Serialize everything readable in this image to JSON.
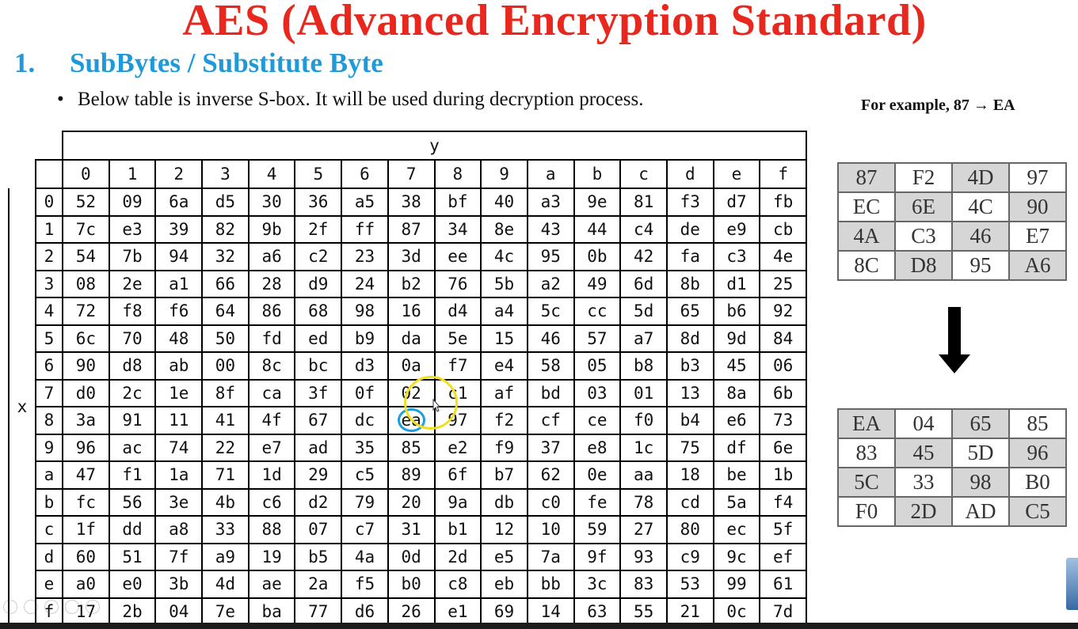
{
  "title": "AES (Advanced Encryption Standard)",
  "section": {
    "number": "1.",
    "heading": "SubBytes / Substitute Byte"
  },
  "bullet": "Below table is inverse S-box. It will be used during decryption process.",
  "example": "For example, 87 → EA",
  "sbox": {
    "y_label": "y",
    "x_label": "x",
    "col_headers": [
      "0",
      "1",
      "2",
      "3",
      "4",
      "5",
      "6",
      "7",
      "8",
      "9",
      "a",
      "b",
      "c",
      "d",
      "e",
      "f"
    ],
    "row_headers": [
      "0",
      "1",
      "2",
      "3",
      "4",
      "5",
      "6",
      "7",
      "8",
      "9",
      "a",
      "b",
      "c",
      "d",
      "e",
      "f"
    ],
    "rows": [
      [
        "52",
        "09",
        "6a",
        "d5",
        "30",
        "36",
        "a5",
        "38",
        "bf",
        "40",
        "a3",
        "9e",
        "81",
        "f3",
        "d7",
        "fb"
      ],
      [
        "7c",
        "e3",
        "39",
        "82",
        "9b",
        "2f",
        "ff",
        "87",
        "34",
        "8e",
        "43",
        "44",
        "c4",
        "de",
        "e9",
        "cb"
      ],
      [
        "54",
        "7b",
        "94",
        "32",
        "a6",
        "c2",
        "23",
        "3d",
        "ee",
        "4c",
        "95",
        "0b",
        "42",
        "fa",
        "c3",
        "4e"
      ],
      [
        "08",
        "2e",
        "a1",
        "66",
        "28",
        "d9",
        "24",
        "b2",
        "76",
        "5b",
        "a2",
        "49",
        "6d",
        "8b",
        "d1",
        "25"
      ],
      [
        "72",
        "f8",
        "f6",
        "64",
        "86",
        "68",
        "98",
        "16",
        "d4",
        "a4",
        "5c",
        "cc",
        "5d",
        "65",
        "b6",
        "92"
      ],
      [
        "6c",
        "70",
        "48",
        "50",
        "fd",
        "ed",
        "b9",
        "da",
        "5e",
        "15",
        "46",
        "57",
        "a7",
        "8d",
        "9d",
        "84"
      ],
      [
        "90",
        "d8",
        "ab",
        "00",
        "8c",
        "bc",
        "d3",
        "0a",
        "f7",
        "e4",
        "58",
        "05",
        "b8",
        "b3",
        "45",
        "06"
      ],
      [
        "d0",
        "2c",
        "1e",
        "8f",
        "ca",
        "3f",
        "0f",
        "02",
        "c1",
        "af",
        "bd",
        "03",
        "01",
        "13",
        "8a",
        "6b"
      ],
      [
        "3a",
        "91",
        "11",
        "41",
        "4f",
        "67",
        "dc",
        "ea",
        "97",
        "f2",
        "cf",
        "ce",
        "f0",
        "b4",
        "e6",
        "73"
      ],
      [
        "96",
        "ac",
        "74",
        "22",
        "e7",
        "ad",
        "35",
        "85",
        "e2",
        "f9",
        "37",
        "e8",
        "1c",
        "75",
        "df",
        "6e"
      ],
      [
        "47",
        "f1",
        "1a",
        "71",
        "1d",
        "29",
        "c5",
        "89",
        "6f",
        "b7",
        "62",
        "0e",
        "aa",
        "18",
        "be",
        "1b"
      ],
      [
        "fc",
        "56",
        "3e",
        "4b",
        "c6",
        "d2",
        "79",
        "20",
        "9a",
        "db",
        "c0",
        "fe",
        "78",
        "cd",
        "5a",
        "f4"
      ],
      [
        "1f",
        "dd",
        "a8",
        "33",
        "88",
        "07",
        "c7",
        "31",
        "b1",
        "12",
        "10",
        "59",
        "27",
        "80",
        "ec",
        "5f"
      ],
      [
        "60",
        "51",
        "7f",
        "a9",
        "19",
        "b5",
        "4a",
        "0d",
        "2d",
        "e5",
        "7a",
        "9f",
        "93",
        "c9",
        "9c",
        "ef"
      ],
      [
        "a0",
        "e0",
        "3b",
        "4d",
        "ae",
        "2a",
        "f5",
        "b0",
        "c8",
        "eb",
        "bb",
        "3c",
        "83",
        "53",
        "99",
        "61"
      ],
      [
        "17",
        "2b",
        "04",
        "7e",
        "ba",
        "77",
        "d6",
        "26",
        "e1",
        "69",
        "14",
        "63",
        "55",
        "21",
        "0c",
        "7d"
      ]
    ],
    "highlight": {
      "row": 8,
      "col": 7,
      "color": "#1aa0e0"
    }
  },
  "state_before": [
    [
      "87",
      "F2",
      "4D",
      "97"
    ],
    [
      "EC",
      "6E",
      "4C",
      "90"
    ],
    [
      "4A",
      "C3",
      "46",
      "E7"
    ],
    [
      "8C",
      "D8",
      "95",
      "A6"
    ]
  ],
  "state_after": [
    [
      "EA",
      "04",
      "65",
      "85"
    ],
    [
      "83",
      "45",
      "5D",
      "96"
    ],
    [
      "5C",
      "33",
      "98",
      "B0"
    ],
    [
      "F0",
      "2D",
      "AD",
      "C5"
    ]
  ],
  "colors": {
    "title": "#e8281e",
    "section": "#1f9ad8",
    "shaded_cell": "#d6d6d6",
    "pointer": "#f3df1e"
  }
}
